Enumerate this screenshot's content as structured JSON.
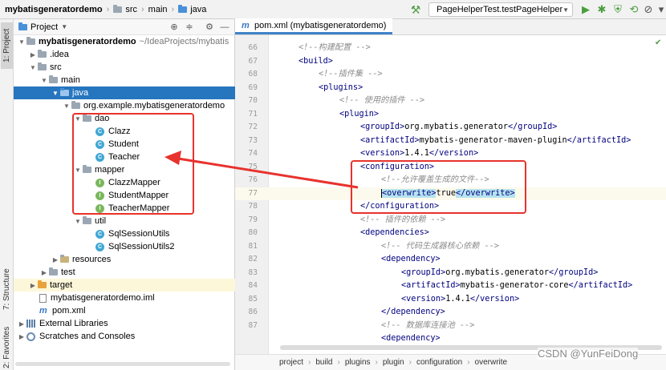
{
  "navbar": {
    "breadcrumbs": [
      "mybatisgeneratordemo",
      "src",
      "main",
      "java"
    ],
    "run_config": "PageHelperTest.testPageHelper"
  },
  "left_stripe": {
    "project_label": "1: Project",
    "structure_label": "7: Structure",
    "favorites_label": "2: Favorites"
  },
  "project_panel": {
    "title": "Project",
    "tree": {
      "root_name": "mybatisgeneratordemo",
      "root_path": "~/IdeaProjects/mybatis",
      "idea": ".idea",
      "src": "src",
      "main": "main",
      "java": "java",
      "package": "org.example.mybatisgeneratordemo",
      "dao": "dao",
      "clazz": "Clazz",
      "student": "Student",
      "teacher": "Teacher",
      "mapper": "mapper",
      "clazz_mapper": "ClazzMapper",
      "student_mapper": "StudentMapper",
      "teacher_mapper": "TeacherMapper",
      "util": "util",
      "sql_session_utils": "SqlSessionUtils",
      "sql_session_utils2": "SqlSessionUtils2",
      "resources": "resources",
      "test": "test",
      "target": "target",
      "iml": "mybatisgeneratordemo.iml",
      "pom": "pom.xml",
      "external_libraries": "External Libraries",
      "scratches": "Scratches and Consoles"
    },
    "icon_letters": {
      "class": "C",
      "interface": "I",
      "maven": "m"
    }
  },
  "editor": {
    "tab_label": "pom.xml (mybatisgeneratordemo)",
    "line_numbers": [
      "66",
      "67",
      "68",
      "69",
      "70",
      "71",
      "72",
      "73",
      "74",
      "75",
      "76",
      "77",
      "78",
      "79",
      "80",
      "81",
      "82",
      "83",
      "84",
      "85",
      "86",
      "87"
    ],
    "code": {
      "l66": "<!--构建配置 -->",
      "l67a": "<build>",
      "l68": "<!--插件集 -->",
      "l69a": "<plugins>",
      "l70": "<!-- 使用的插件 -->",
      "l71a": "<plugin>",
      "l72a": "<groupId>",
      "l72b": "org.mybatis.generator",
      "l72c": "</groupId>",
      "l73a": "<artifactId>",
      "l73b": "mybatis-generator-maven-plugin",
      "l73c": "</artifactId>",
      "l74a": "<version>",
      "l74b": "1.4.1",
      "l74c": "</version>",
      "l75a": "<configuration>",
      "l76": "<!--允许覆盖生成的文件-->",
      "l77a": "<overwrite>",
      "l77b": "true",
      "l77c": "</overwrite>",
      "l78a": "</configuration>",
      "l79": "<!-- 插件的依赖 -->",
      "l80a": "<dependencies>",
      "l81": "<!-- 代码生成器核心依赖 -->",
      "l82a": "<dependency>",
      "l83a": "<groupId>",
      "l83b": "org.mybatis.generator",
      "l83c": "</groupId>",
      "l84a": "<artifactId>",
      "l84b": "mybatis-generator-core",
      "l84c": "</artifactId>",
      "l85a": "<version>",
      "l85b": "1.4.1",
      "l85c": "</version>",
      "l86a": "</dependency>",
      "l87": "<!-- 数据库连接池 -->",
      "l88a": "<dependency>"
    },
    "breadcrumb": [
      "project",
      "build",
      "plugins",
      "plugin",
      "configuration",
      "overwrite"
    ]
  },
  "watermark": "CSDN @YunFeiDong",
  "colors": {
    "selection": "#2675bf",
    "annotation_red": "#e8322d",
    "xml_tag": "#000080",
    "comment": "#8c8c8c"
  }
}
